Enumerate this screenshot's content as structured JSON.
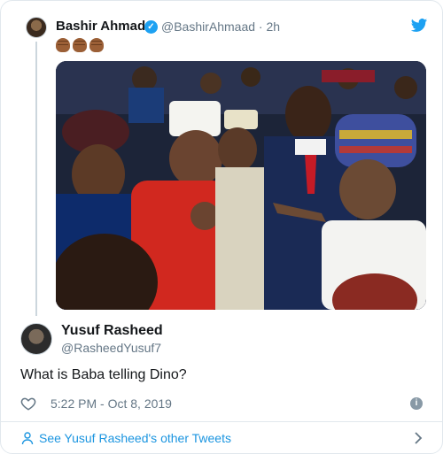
{
  "parent_tweet": {
    "name": "Bashir Ahmad",
    "verified": true,
    "handle_time": "@BashirAhmaad · 2h",
    "emoji": [
      "fist-emoji",
      "fist-emoji",
      "fist-emoji"
    ],
    "photo_description_icon": "photo"
  },
  "main_tweet": {
    "name": "Yusuf Rasheed",
    "handle": "@RasheedYusuf7",
    "text": "What is Baba telling Dino?",
    "timestamp": "5:22 PM - Oct 8, 2019"
  },
  "footer": {
    "link_label": "See Yusuf Rasheed's other Tweets"
  },
  "colors": {
    "link": "#1b95e0",
    "verified": "#1da1f2",
    "muted": "#657786",
    "border": "#e1e8ed"
  }
}
